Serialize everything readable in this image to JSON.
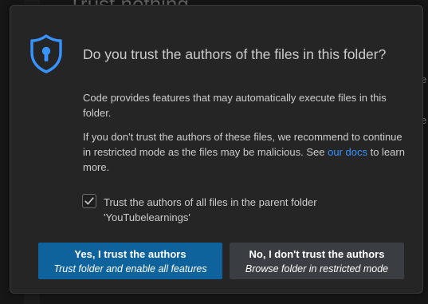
{
  "background": {
    "partial_title": "Trust nothing",
    "partial_right_1": "e",
    "partial_right_2": "e"
  },
  "dialog": {
    "icon": "shield-lock-icon",
    "title": "Do you trust the authors of the files in this folder?",
    "paragraph1": "Code provides features that may automatically execute files in this folder.",
    "paragraph2_prefix": "If you don't trust the authors of these files, we recommend to continue in restricted mode as the files may be malicious. See ",
    "paragraph2_link": "our docs",
    "paragraph2_suffix": " to learn more.",
    "checkbox": {
      "checked": true,
      "label_line1": "Trust the authors of all files in the parent folder",
      "label_line2": "'YouTubelearnings'"
    },
    "buttons": {
      "trust": {
        "label": "Yes, I trust the authors",
        "sublabel": "Trust folder and enable all features"
      },
      "distrust": {
        "label": "No, I don't trust the authors",
        "sublabel": "Browse folder in restricted mode"
      }
    },
    "colors": {
      "accent": "#0e639c",
      "link": "#3794ff",
      "icon": "#3794ff",
      "dialog_bg": "#252526",
      "text": "#cccccc"
    }
  }
}
